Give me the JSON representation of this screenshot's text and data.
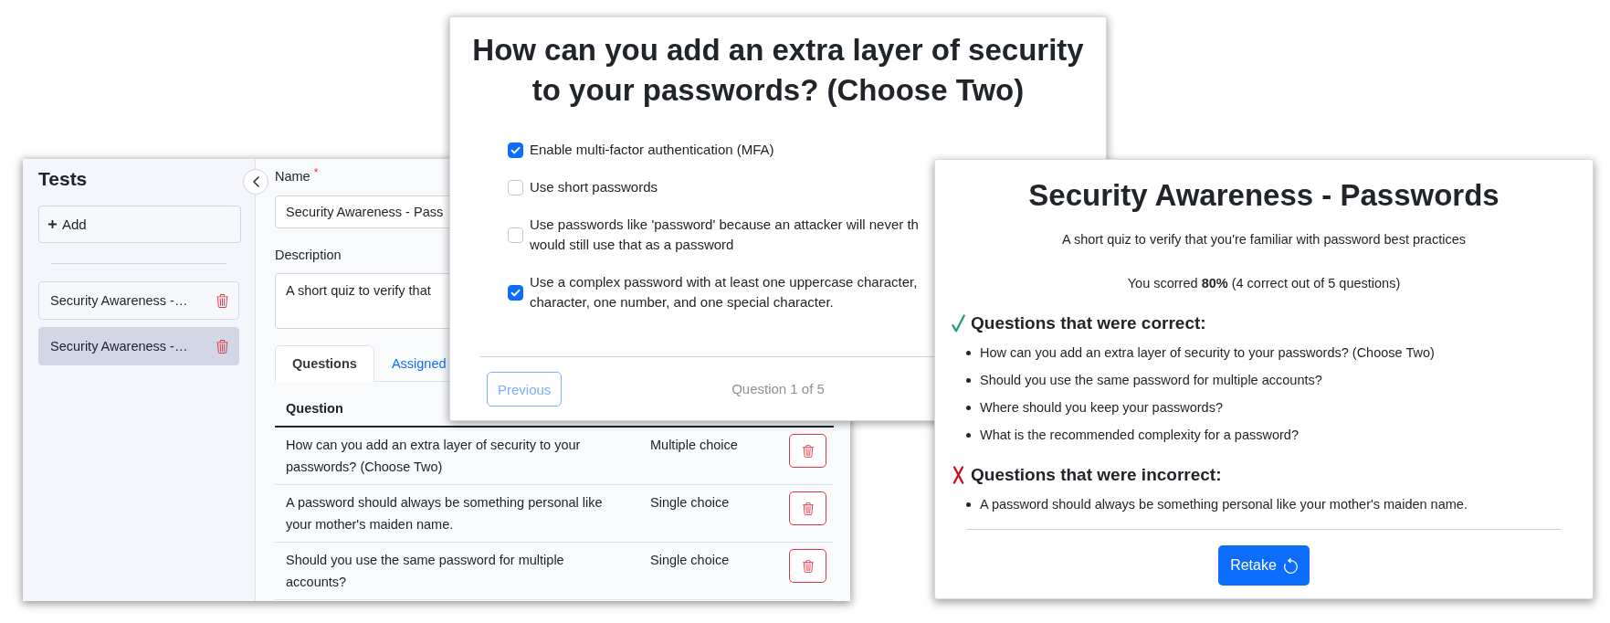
{
  "editor": {
    "sidebar": {
      "title": "Tests",
      "add_label": "Add",
      "items": [
        {
          "label": "Security Awareness -…",
          "selected": false
        },
        {
          "label": "Security Awareness -…",
          "selected": true
        }
      ]
    },
    "name_field": {
      "label": "Name",
      "required_mark": "*",
      "value": "Security Awareness - Pass"
    },
    "description_field": {
      "label": "Description",
      "value": "A short quiz to verify that"
    },
    "tabs": [
      {
        "label": "Questions",
        "selected": true
      },
      {
        "label": "Assigned",
        "selected": false
      }
    ],
    "table": {
      "columns": [
        "Question"
      ],
      "rows": [
        {
          "question": "How can you add an extra layer of security to your passwords? (Choose Two)",
          "type": "Multiple choice"
        },
        {
          "question": "A password should always be something personal like your mother's maiden name.",
          "type": "Single choice"
        },
        {
          "question": "Should you use the same password for multiple accounts?",
          "type": "Single choice"
        }
      ]
    }
  },
  "question_card": {
    "title": "How can you add an extra layer of security to your passwords? (Choose Two)",
    "options": [
      {
        "lines": [
          "Enable multi-factor authentication (MFA)"
        ],
        "checked": true
      },
      {
        "lines": [
          "Use short passwords"
        ],
        "checked": false
      },
      {
        "lines": [
          "Use passwords like 'password' because an attacker will never th",
          "would still use that as a password"
        ],
        "checked": false
      },
      {
        "lines": [
          "Use a complex password with at least one uppercase character,",
          "character, one number, and one special character."
        ],
        "checked": true
      }
    ],
    "previous_button": {
      "label": "Previous",
      "disabled": true
    },
    "progress": "Question 1 of 5"
  },
  "results_card": {
    "title": "Security Awareness - Passwords",
    "description": "A short quiz to verify that you're familiar with password best practices",
    "score": "You scorred **80%** (4 correct out of 5 questions)",
    "sections": [
      {
        "kind": "correct",
        "heading": "Questions that were correct:",
        "items": [
          "How can you add an extra layer of security to your passwords? (Choose Two)",
          "Should you use the same password for multiple accounts?",
          "Where should you keep your passwords?",
          "What is the recommended complexity for a password?"
        ]
      },
      {
        "kind": "incorrect",
        "heading": "Questions that were incorrect:",
        "items": [
          "A password should always be something personal like your mother's maiden name."
        ]
      }
    ],
    "retake_button": {
      "label": "Retake"
    }
  }
}
